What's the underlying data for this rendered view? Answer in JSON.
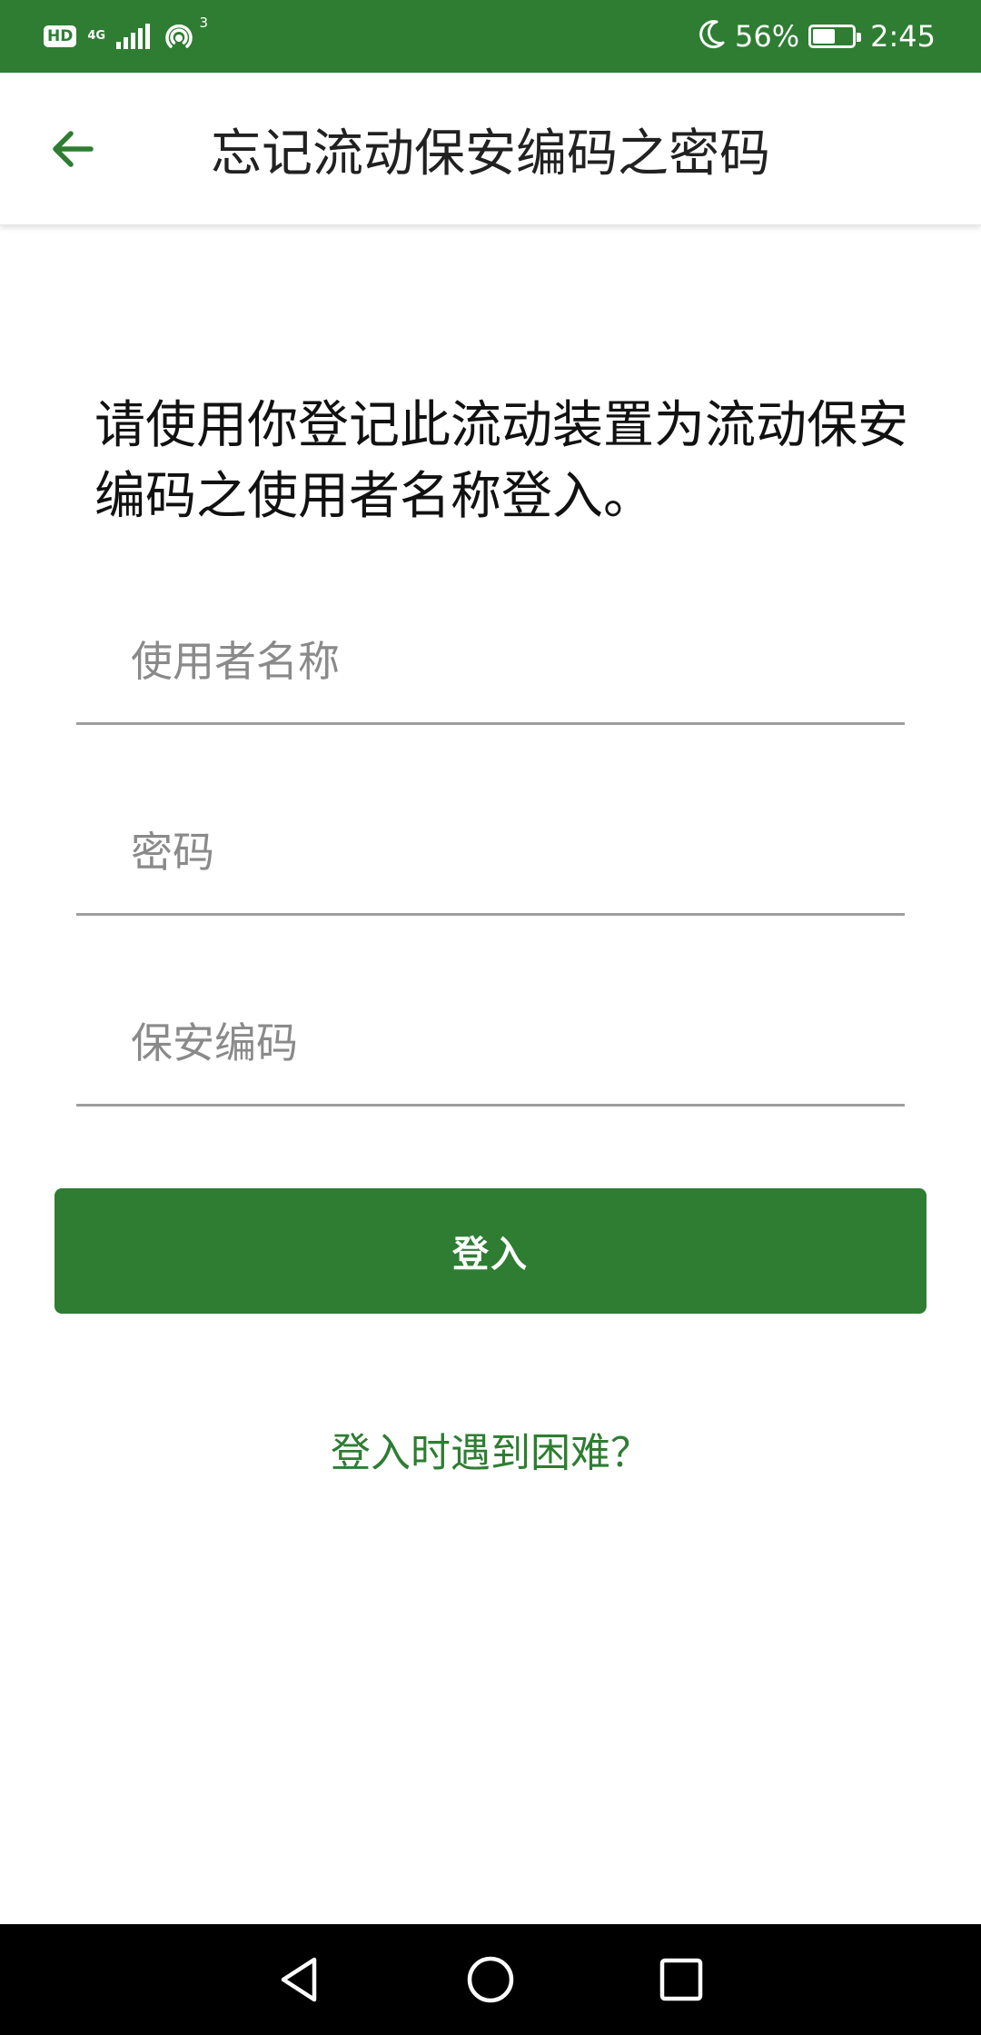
{
  "status_bar": {
    "hd": "HD",
    "network_type": "4G",
    "hotspot_count": "3",
    "battery_percent": "56%",
    "battery_level": 0.56,
    "time": "2:45",
    "icons": [
      "signal-icon",
      "hotspot-icon",
      "moon-icon",
      "battery-icon"
    ]
  },
  "app_bar": {
    "back_icon": "arrow-left-icon",
    "title": "忘记流动保安编码之密码"
  },
  "main": {
    "instruction": "请使用你登记此流动装置为流动保安编码之使用者名称登入。",
    "fields": {
      "username_placeholder": "使用者名称",
      "username_value": "",
      "password_placeholder": "密码",
      "password_value": "",
      "security_code_placeholder": "保安编码",
      "security_code_value": ""
    },
    "login_button": "登入",
    "help_link": "登入时遇到困难？"
  },
  "nav_bar": {
    "icons": [
      "back-triangle-icon",
      "home-circle-icon",
      "recents-square-icon"
    ]
  },
  "colors": {
    "accent": "#2e7d32",
    "field_underline": "#9e9e9e",
    "placeholder": "#8a8a8a",
    "nav_background": "#000000"
  }
}
